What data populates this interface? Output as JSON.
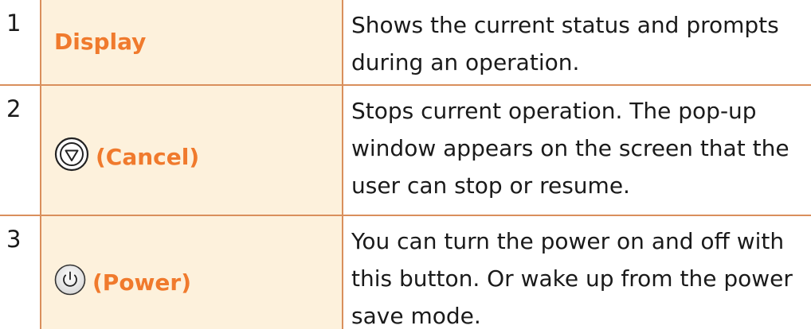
{
  "rows": [
    {
      "number": "1",
      "name": "Display",
      "description": "Shows the current status and prompts during an operation."
    },
    {
      "number": "2",
      "icon": "cancel-stop-icon",
      "name": "(Cancel)",
      "description": "Stops current operation. The pop-up window appears on the screen that the user can stop or resume."
    },
    {
      "number": "3",
      "icon": "power-icon",
      "name": "(Power)",
      "description": "You can turn the power on and off with this button. Or wake up from the power save mode."
    }
  ],
  "colors": {
    "accent": "#f07a2d",
    "border": "#d98f5c",
    "name_cell_bg": "#fdf1dc",
    "text": "#1a1a1a"
  }
}
